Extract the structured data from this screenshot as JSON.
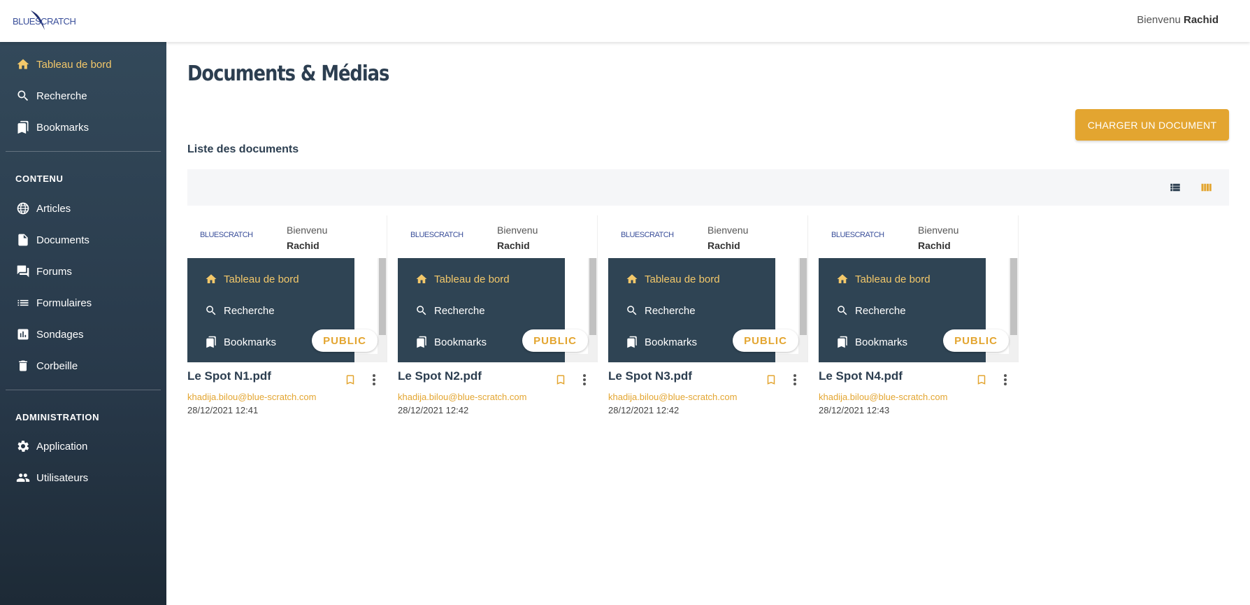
{
  "app": {
    "logo_text": "BLUESCRATCH",
    "welcome_prefix": "Bienvenu",
    "user_name": "Rachid"
  },
  "sidebar": {
    "items": [
      {
        "label": "Tableau de bord",
        "icon": "home-icon"
      },
      {
        "label": "Recherche",
        "icon": "search-icon"
      },
      {
        "label": "Bookmarks",
        "icon": "bookmarks-icon"
      }
    ],
    "section_content": "CONTENU",
    "content_items": [
      {
        "label": "Articles",
        "icon": "globe-icon"
      },
      {
        "label": "Documents",
        "icon": "document-icon"
      },
      {
        "label": "Forums",
        "icon": "forum-icon"
      },
      {
        "label": "Formulaires",
        "icon": "list-icon"
      },
      {
        "label": "Sondages",
        "icon": "poll-icon"
      },
      {
        "label": "Corbeille",
        "icon": "trash-icon"
      }
    ],
    "section_admin": "ADMINISTRATION",
    "admin_items": [
      {
        "label": "Application",
        "icon": "gear-icon"
      },
      {
        "label": "Utilisateurs",
        "icon": "users-icon"
      }
    ]
  },
  "main": {
    "title": "Documents & Médias",
    "upload_button": "CHARGER UN DOCUMENT",
    "list_title": "Liste des documents"
  },
  "accent_color": "#e3a530",
  "sidebar_color": "#2f4454",
  "thumbnail": {
    "welcome": "Bienvenu",
    "user": "Rachid",
    "items": [
      "Tableau de bord",
      "Recherche",
      "Bookmarks"
    ],
    "badge": "PUBLIC"
  },
  "documents": [
    {
      "name": "Le Spot N1.pdf",
      "author": "khadija.bilou@blue-scratch.com",
      "date": "28/12/2021 12:41"
    },
    {
      "name": "Le Spot N2.pdf",
      "author": "khadija.bilou@blue-scratch.com",
      "date": "28/12/2021 12:42"
    },
    {
      "name": "Le Spot N3.pdf",
      "author": "khadija.bilou@blue-scratch.com",
      "date": "28/12/2021 12:42"
    },
    {
      "name": "Le Spot N4.pdf",
      "author": "khadija.bilou@blue-scratch.com",
      "date": "28/12/2021 12:43"
    }
  ]
}
